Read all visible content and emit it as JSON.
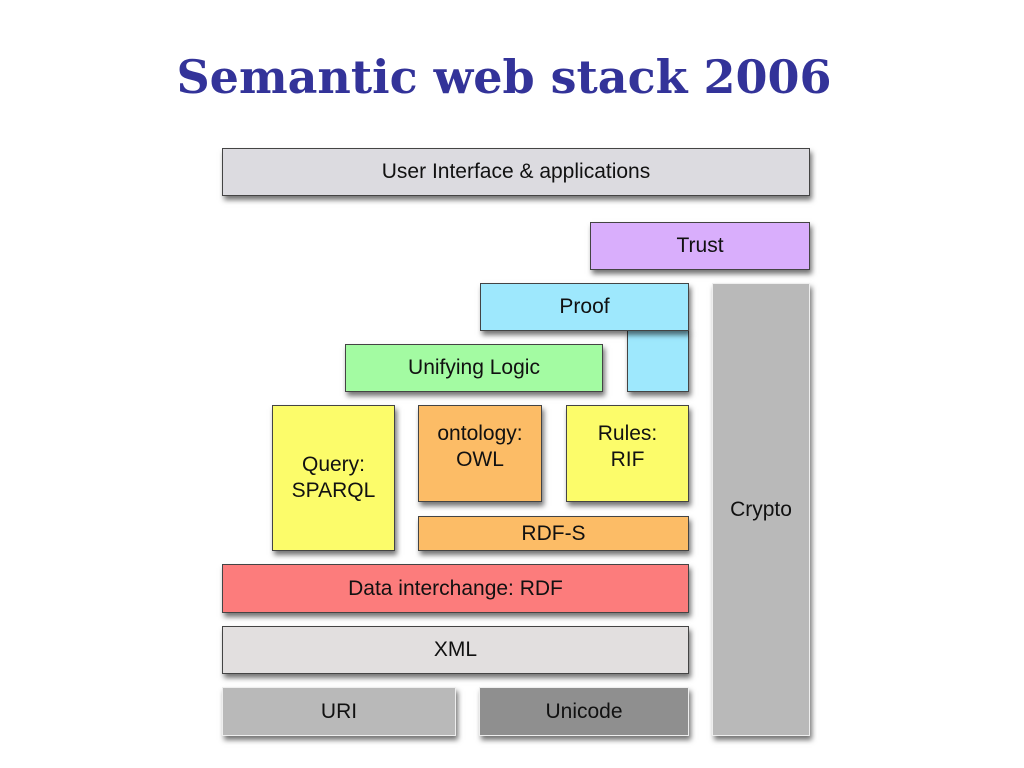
{
  "title": "Semantic web stack 2006",
  "layers": {
    "ui": {
      "label": "User Interface & applications",
      "color": "#dcdbe0"
    },
    "trust": {
      "label": "Trust",
      "color": "#d9aefc"
    },
    "proof": {
      "label": "Proof",
      "color": "#9ee8fd"
    },
    "unifying_logic": {
      "label": "Unifying Logic",
      "color": "#a3fba2"
    },
    "query": {
      "label": "Query:\nSPARQL",
      "color": "#fcfc6a"
    },
    "ontology": {
      "label": "ontology:\nOWL",
      "color": "#fcbc66"
    },
    "rules": {
      "label": "Rules:\nRIF",
      "color": "#fcfc6a"
    },
    "rdfs": {
      "label": "RDF-S",
      "color": "#fcbc66"
    },
    "rdf": {
      "label": "Data interchange: RDF",
      "color": "#fc7c7c"
    },
    "xml": {
      "label": "XML",
      "color": "#e2dfdf"
    },
    "uri": {
      "label": "URI",
      "color": "#b9b9b9"
    },
    "unicode": {
      "label": "Unicode",
      "color": "#8f8f8f"
    },
    "crypto": {
      "label": "Crypto",
      "color": "#b9b9b9"
    }
  }
}
